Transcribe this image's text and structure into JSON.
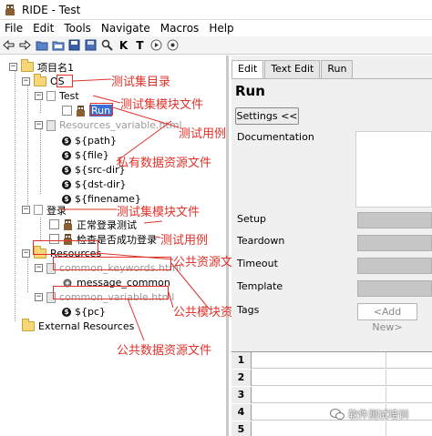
{
  "window": {
    "title": "RIDE - Test"
  },
  "menubar": [
    "File",
    "Edit",
    "Tools",
    "Navigate",
    "Macros",
    "Help"
  ],
  "toolbar": {
    "icons": [
      "back-arrow-icon",
      "forward-arrow-icon",
      "open-file-icon",
      "open-directory-icon",
      "save-icon",
      "save-all-icon",
      "search-keyword-icon",
      "keyword-k-icon",
      "test-t-icon",
      "run-icon",
      "stop-icon"
    ],
    "k_label": "K",
    "t_label": "T"
  },
  "tree": {
    "root": "项目名1",
    "os": "OS",
    "test": "Test",
    "run": "Run",
    "resources_variable": "Resources_variable.html",
    "vars": [
      "${path}",
      "${file}",
      "${src-dir}",
      "${dst-dir}",
      "${finename}"
    ],
    "login": "登录",
    "login_tests": [
      "正常登录测试",
      "检查是否成功登录"
    ],
    "resources": "Resources",
    "common_keywords": "common_keywords.html",
    "message_common": "message_common",
    "common_variable": "common_variable.html",
    "pc": "${pc}",
    "external": "External Resources"
  },
  "annotations": {
    "suite_dir": "测试集目录",
    "suite_file_1": "测试集模块文件",
    "testcase_1": "测试用例",
    "private_data": "私有数据资源文件",
    "suite_file_2": "测试集模块文件",
    "testcase_2": "测试用例",
    "public_dir": "公共资源文件目录",
    "public_module": "公共模块资源文件",
    "public_data": "公共数据资源文件"
  },
  "editor": {
    "tabs": [
      "Edit",
      "Text Edit",
      "Run"
    ],
    "active_tab": "Edit",
    "title": "Run",
    "settings_button": "Settings <<",
    "fields": {
      "documentation": "Documentation",
      "setup": "Setup",
      "teardown": "Teardown",
      "timeout": "Timeout",
      "template": "Template",
      "tags": "Tags"
    },
    "add_new": "<Add New>",
    "grid_rows": [
      "1",
      "2",
      "3",
      "4",
      "5"
    ]
  },
  "watermark": "软件测试培训",
  "colors": {
    "annotation": "#e0322a",
    "selection": "#3a6fd6"
  }
}
